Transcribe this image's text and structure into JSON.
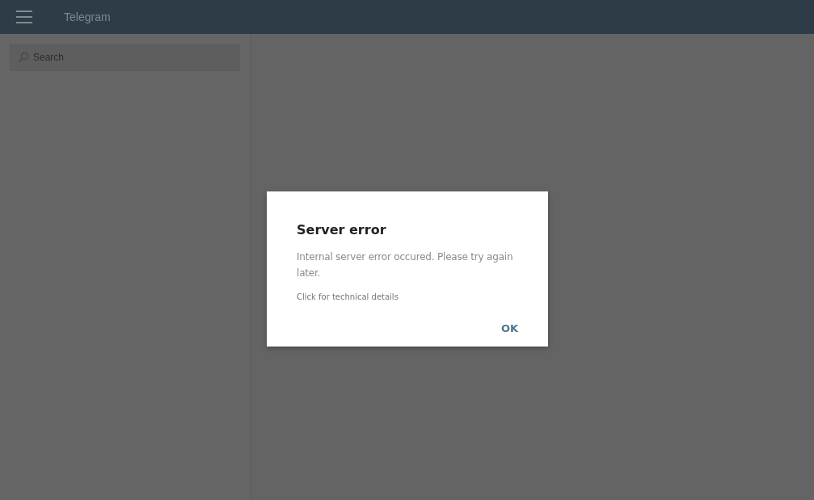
{
  "header": {
    "title": "Telegram"
  },
  "sidebar": {
    "search": {
      "placeholder": "Search"
    }
  },
  "dialog": {
    "title": "Server error",
    "message": "Internal server error occured. Please try again later.",
    "details_link": "Click for technical details",
    "buttons": [
      "OK"
    ]
  }
}
